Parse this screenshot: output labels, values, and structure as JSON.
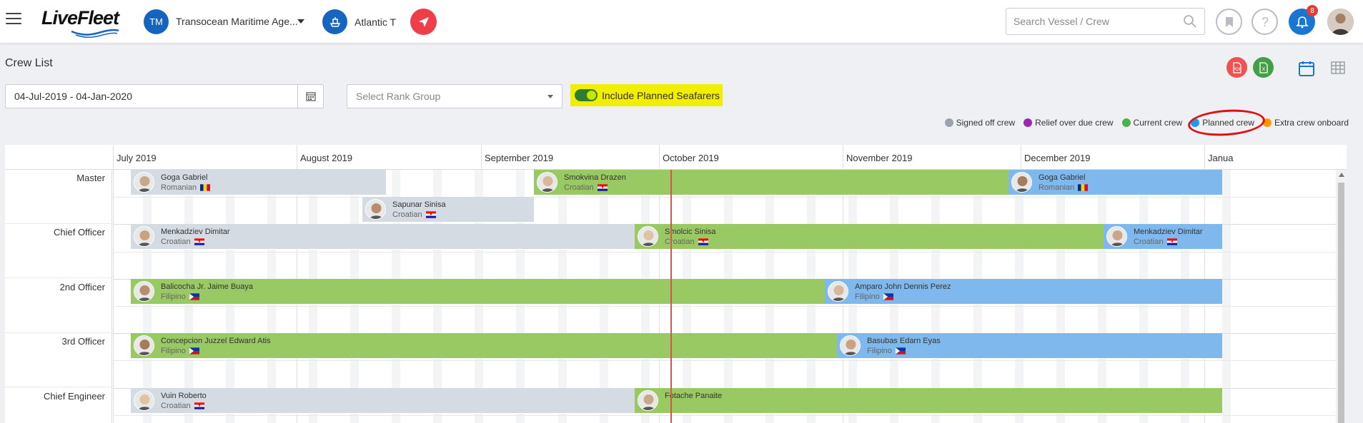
{
  "app": {
    "logo": "LiveFleet"
  },
  "header": {
    "company_initials": "TM",
    "company_name": "Transocean Maritime Age...",
    "vessel_name": "Atlantic T",
    "search_placeholder": "Search Vessel / Crew",
    "notification_count": "8"
  },
  "page": {
    "title": "Crew List",
    "date_range": "04-Jul-2019 - 04-Jan-2020",
    "rank_placeholder": "Select Rank Group",
    "toggle_label": "Include Planned Seafarers",
    "toggle_on": true
  },
  "legend": [
    {
      "label": "Signed off crew",
      "color": "#9aa3ad"
    },
    {
      "label": "Relief over due crew",
      "color": "#9c27b0"
    },
    {
      "label": "Current crew",
      "color": "#4caf50"
    },
    {
      "label": "Planned crew",
      "color": "#2196f3"
    },
    {
      "label": "Extra crew onboard",
      "color": "#ff9800"
    }
  ],
  "timeline": {
    "months": [
      "July 2019",
      "August 2019",
      "September 2019",
      "October 2019",
      "November 2019",
      "December 2019",
      "Janua"
    ],
    "ranks": [
      "Master",
      "Chief Officer",
      "2nd Officer",
      "3rd Officer",
      "Chief Engineer"
    ],
    "crew": [
      {
        "name": "Goga Gabriel",
        "nationality": "Romanian",
        "status": "signed",
        "rank": "Master",
        "start": "04-Jul-2019",
        "end": "16-Aug-2019",
        "flag": "ro"
      },
      {
        "name": "Sapunar Sinisa",
        "nationality": "Croatian",
        "status": "signed",
        "rank": "Master",
        "start": "12-Aug-2019",
        "end": "10-Sep-2019",
        "flag": "hr"
      },
      {
        "name": "Smokvina Drazen",
        "nationality": "Croatian",
        "status": "current",
        "rank": "Master",
        "start": "10-Sep-2019",
        "end": "29-Nov-2019",
        "flag": "hr"
      },
      {
        "name": "Goga Gabriel",
        "nationality": "Romanian",
        "status": "planned",
        "rank": "Master",
        "start": "29-Nov-2019",
        "end": "04-Jan-2020",
        "flag": "ro"
      },
      {
        "name": "Menkadziev Dimitar",
        "nationality": "Croatian",
        "status": "signed",
        "rank": "Chief Officer",
        "start": "04-Jul-2019",
        "end": "27-Sep-2019",
        "flag": "hr"
      },
      {
        "name": "Smolcic Sinisa",
        "nationality": "Croatian",
        "status": "current",
        "rank": "Chief Officer",
        "start": "27-Sep-2019",
        "end": "15-Dec-2019",
        "flag": "hr"
      },
      {
        "name": "Menkadziev Dimitar",
        "nationality": "Croatian",
        "status": "planned",
        "rank": "Chief Officer",
        "start": "15-Dec-2019",
        "end": "04-Jan-2020",
        "flag": "hr"
      },
      {
        "name": "Balicocha Jr. Jaime Buaya",
        "nationality": "Filipino",
        "status": "current",
        "rank": "2nd Officer",
        "start": "04-Jul-2019",
        "end": "29-Oct-2019",
        "flag": "ph"
      },
      {
        "name": "Amparo John Dennis Perez",
        "nationality": "Filipino",
        "status": "planned",
        "rank": "2nd Officer",
        "start": "29-Oct-2019",
        "end": "04-Jan-2020",
        "flag": "ph"
      },
      {
        "name": "Concepcion Juzzel Edward Atis",
        "nationality": "Filipino",
        "status": "current",
        "rank": "3rd Officer",
        "start": "04-Jul-2019",
        "end": "31-Oct-2019",
        "flag": "ph"
      },
      {
        "name": "Basubas Edarn Eyas",
        "nationality": "Filipino",
        "status": "planned",
        "rank": "3rd Officer",
        "start": "31-Oct-2019",
        "end": "04-Jan-2020",
        "flag": "ph"
      },
      {
        "name": "Vuin Roberto",
        "nationality": "Croatian",
        "status": "signed",
        "rank": "Chief Engineer",
        "start": "04-Jul-2019",
        "end": "27-Sep-2019",
        "flag": "hr"
      },
      {
        "name": "Fotache Panaite",
        "nationality": "",
        "status": "current",
        "rank": "Chief Engineer",
        "start": "27-Sep-2019",
        "end": "04-Jan-2020",
        "flag": "ro"
      }
    ],
    "today": "03-Oct-2019"
  }
}
